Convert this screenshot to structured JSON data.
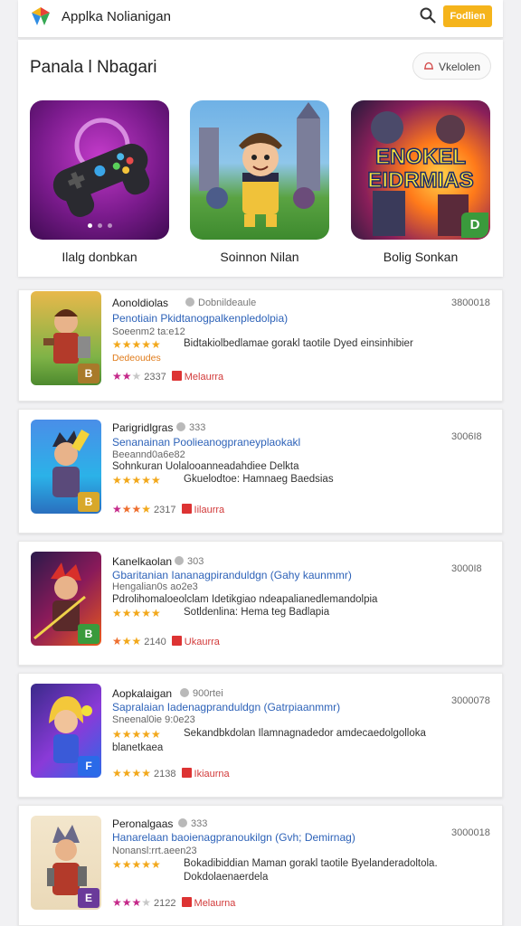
{
  "app": {
    "title": "Applka Nolianigan",
    "top_button": "Fodlien"
  },
  "featured": {
    "title": "Panala l Nbagari",
    "pill_label": "Vkelolen",
    "tiles": [
      {
        "label": "Ilalg donbkan",
        "badge": ""
      },
      {
        "label": "Soinnon Nilan",
        "badge": ""
      },
      {
        "label": "Bolig Sonkan",
        "banner_line1": "ENOKEL",
        "banner_line2": "EIDRMIAS",
        "badge": "D"
      }
    ]
  },
  "cards": [
    {
      "name": "Aonoldiolas",
      "sub": "Dobnildeaule",
      "link": "Penotiain Pkidtanogpalkenpledolpia)",
      "meta": "Soeenm2 ta:e12",
      "line": "Bidtakiolbedlamae gorakl taotile Dyed einsinhibier",
      "orange": "Dedeoudes",
      "stars_rating": "2337",
      "rating_word": "Melaurra",
      "right": "3800018",
      "badge": "B"
    },
    {
      "name": "Parigridlgras",
      "sub": "333",
      "link": "Senanainan Poolieanogpraneyplaokakl",
      "meta": "Beeannd0a6e82",
      "line": "Sohnkuran Uolalooanneadahdiee Delkta",
      "line2": "Gkuelodtoe: Hamnaeg Baedsias",
      "stars_rating": "2317",
      "rating_word": "Iilaurra",
      "right": "3006I8",
      "badge": "B"
    },
    {
      "name": "Kanelkaolan",
      "sub": "303",
      "link": "Gbaritanian Iananagpiranduldgn (Gahy kaunmmr)",
      "meta": "Hengalian0s ao2e3",
      "line": "Pdrolihomaloeolclam Idetikgiao ndeapalianedlemandolpia",
      "line2": "Sotldenlina: Hema teg Badlapia",
      "stars_rating": "2140",
      "rating_word": "Ukaurra",
      "right": "3000I8",
      "badge": "B"
    },
    {
      "name": "Aopkalaigan",
      "sub": "900rtei",
      "link": "Sapralaian Iadenagpranduldgn (Gatrpiaanmmr)",
      "meta": "Sneenal0ie 9:0e23",
      "line": "Sekandbkdolan Ilamnagnadedor amdecaedolgolloka",
      "line2": "blanetkaea",
      "stars_rating": "2138",
      "rating_word": "Ikiaurna",
      "right": "3000078",
      "badge": "F"
    },
    {
      "name": "Peronalgaas",
      "sub": "333",
      "link": "Hanarelaan baoienagpranoukilgn (Gvh; Demirnag)",
      "meta": "Nonansl:rrt.aeen23",
      "line": "Bokadibiddian Maman gorakl taotile Byelanderadoltola.",
      "line2": "Dokdolaenaerdela",
      "stars_rating": "2122",
      "rating_word": "Melaurna",
      "right": "3000018",
      "badge": "E"
    }
  ]
}
